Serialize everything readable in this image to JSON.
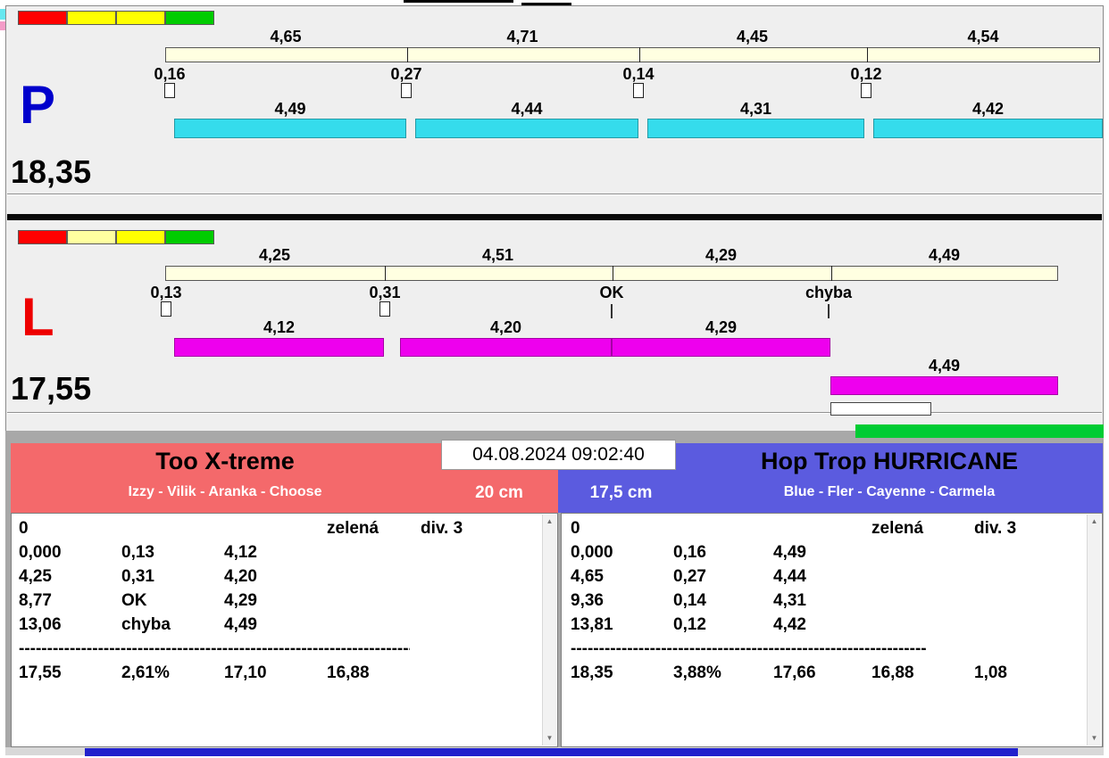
{
  "icons": {
    "scroll_up": "▲",
    "scroll_down": "▼"
  },
  "datetime": "04.08.2024 09:02:40",
  "lane_p": {
    "letter": "P",
    "letter_color": "#0000cc",
    "total": "18,35",
    "status_colors": [
      "#ff0000",
      "#ffff00",
      "#ffff00",
      "#00cc00"
    ],
    "track_color": "#ffffe1",
    "bar_color": "#35dcec",
    "top_splits": [
      "4,65",
      "4,71",
      "4,45",
      "4,54"
    ],
    "marks": [
      "0,16",
      "0,27",
      "0,14",
      "0,12"
    ],
    "bottom_splits": [
      "4,49",
      "4,44",
      "4,31",
      "4,42"
    ]
  },
  "lane_l": {
    "letter": "L",
    "letter_color": "#ee0000",
    "total": "17,55",
    "status_colors": [
      "#ff0000",
      "#ffffa0",
      "#ffff00",
      "#00cc00"
    ],
    "track_color": "#ffffe1",
    "bar_color": "#ee00ee",
    "extra_bar_color": "#00cc33",
    "top_splits": [
      "4,25",
      "4,51",
      "4,29",
      "4,49"
    ],
    "marks": [
      "0,13",
      "0,31",
      "OK",
      "chyba"
    ],
    "bottom_splits": [
      "4,12",
      "4,20",
      "4,29",
      "4,49"
    ]
  },
  "teams": {
    "left": {
      "name": "Too X-treme",
      "members": "Izzy - Vilik - Aranka - Choose",
      "jump_height": "20 cm",
      "header_color": "#f4696b",
      "rows": [
        [
          "0",
          "",
          "",
          "zelená",
          "div. 3"
        ],
        [
          "0,000",
          "0,13",
          "4,12",
          "",
          ""
        ],
        [
          "4,25",
          "0,31",
          "4,20",
          "",
          ""
        ],
        [
          "8,77",
          "OK",
          "4,29",
          "",
          ""
        ],
        [
          "13,06",
          "chyba",
          "4,49",
          "",
          ""
        ]
      ],
      "separator": "--------------------------------------------------------------------------",
      "summary": [
        "17,55",
        "2,61%",
        "17,10",
        "16,88",
        ""
      ]
    },
    "right": {
      "name": "Hop Trop HURRICANE",
      "members": "Blue - Fler - Cayenne - Carmela",
      "jump_height": "17,5 cm",
      "header_color": "#5b5bdf",
      "rows": [
        [
          "0",
          "",
          "",
          "zelená",
          "div. 3"
        ],
        [
          "0,000",
          "0,16",
          "4,49",
          "",
          ""
        ],
        [
          "4,65",
          "0,27",
          "4,44",
          "",
          ""
        ],
        [
          "9,36",
          "0,14",
          "4,31",
          "",
          ""
        ],
        [
          "13,81",
          "0,12",
          "4,42",
          "",
          ""
        ]
      ],
      "separator": "--------------------------------------------------------------------------",
      "summary": [
        "18,35",
        "3,88%",
        "17,66",
        "16,88",
        "1,08"
      ]
    }
  }
}
